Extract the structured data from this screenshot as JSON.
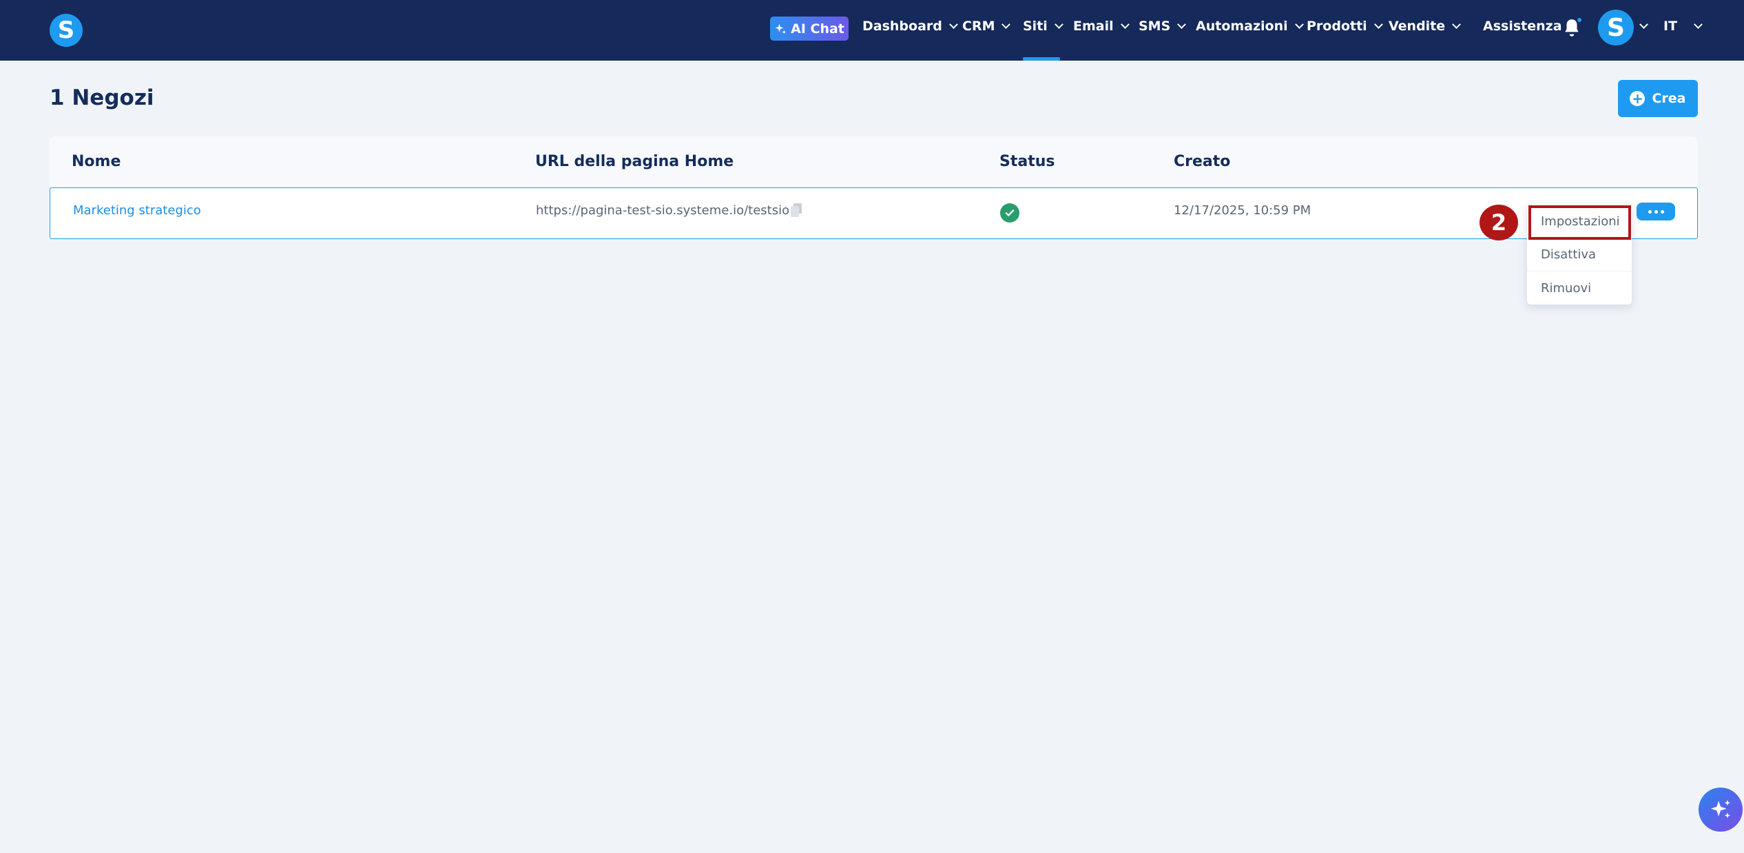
{
  "brand": {
    "logo_letter": "S"
  },
  "nav": {
    "ai_chat": "AI Chat",
    "items": [
      {
        "label": "Dashboard",
        "has_dropdown": true
      },
      {
        "label": "CRM",
        "has_dropdown": true
      },
      {
        "label": "Siti",
        "has_dropdown": true,
        "active": true
      },
      {
        "label": "Email",
        "has_dropdown": true
      },
      {
        "label": "SMS",
        "has_dropdown": true
      },
      {
        "label": "Automazioni",
        "has_dropdown": true
      },
      {
        "label": "Prodotti",
        "has_dropdown": true
      },
      {
        "label": "Vendite",
        "has_dropdown": true
      }
    ],
    "assistenza": "Assistenza",
    "avatar_letter": "S",
    "language": "IT"
  },
  "page": {
    "title": "1 Negozi",
    "create_label": "Crea"
  },
  "table": {
    "columns": [
      "Nome",
      "URL della pagina Home",
      "Status",
      "Creato"
    ],
    "rows": [
      {
        "name": "Marketing strategico",
        "url": "https://pagina-test-sio.systeme.io/testsio",
        "status": "active",
        "created": "12/17/2025, 10:59 PM"
      }
    ]
  },
  "menu": {
    "items": [
      "Impostazioni",
      "Disattiva",
      "Rimuovi"
    ],
    "highlighted": "Impostazioni"
  },
  "annotation": {
    "step": "2"
  },
  "colors": {
    "navbar": "#15295a",
    "accent": "#1e9bf0",
    "highlight": "#b01818",
    "success": "#2a9d6c"
  }
}
